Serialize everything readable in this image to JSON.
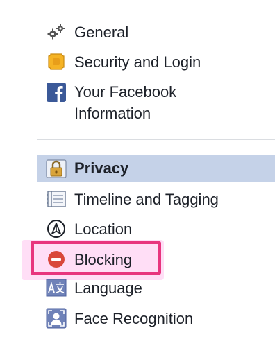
{
  "menu": {
    "general": {
      "label": "General",
      "icon": "gears-icon"
    },
    "security": {
      "label": "Security and Login",
      "icon": "shield-badge-icon"
    },
    "facebook_info": {
      "label": "Your Facebook Information",
      "icon": "facebook-logo-icon"
    },
    "privacy": {
      "label": "Privacy",
      "icon": "padlock-icon"
    },
    "timeline": {
      "label": "Timeline and Tagging",
      "icon": "timeline-icon"
    },
    "location": {
      "label": "Location",
      "icon": "location-arrow-icon"
    },
    "blocking": {
      "label": "Blocking",
      "icon": "block-icon"
    },
    "language": {
      "label": "Language",
      "icon": "translate-icon"
    },
    "face": {
      "label": "Face Recognition",
      "icon": "face-recognition-icon"
    }
  },
  "colors": {
    "selected_bg": "#c5d2e8",
    "highlight_border": "#e8357e",
    "highlight_fill": "#ffb6ea",
    "facebook_blue": "#3b5998",
    "block_red": "#d9483b"
  }
}
